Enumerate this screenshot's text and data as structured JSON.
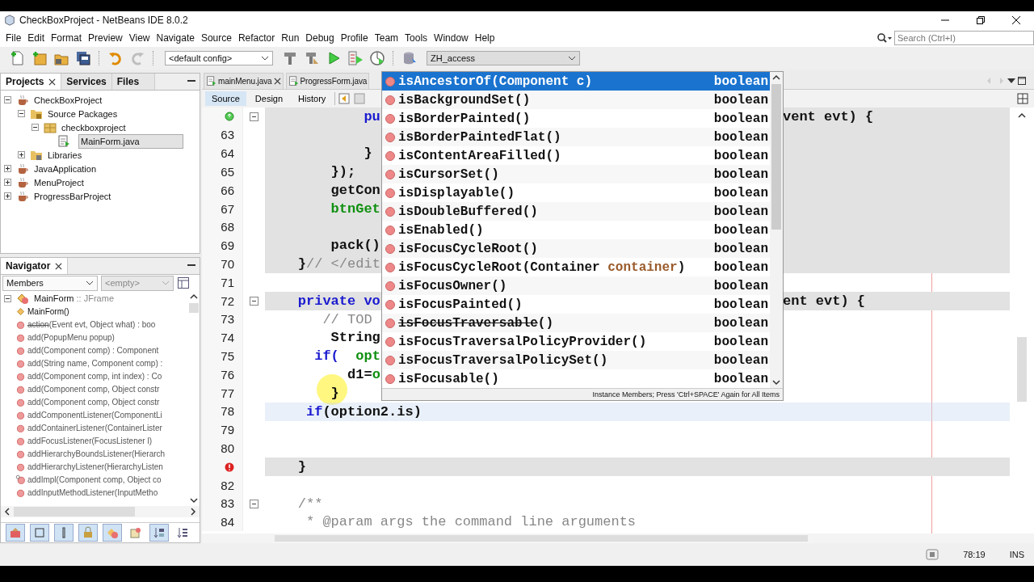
{
  "window": {
    "title": "CheckBoxProject - NetBeans IDE 8.0.2"
  },
  "menu": [
    "File",
    "Edit",
    "Format",
    "Preview",
    "View",
    "Navigate",
    "Source",
    "Refactor",
    "Run",
    "Debug",
    "Profile",
    "Team",
    "Tools",
    "Window",
    "Help"
  ],
  "search": {
    "placeholder": "Search (Ctrl+I)"
  },
  "toolbar": [
    {
      "kind": "new-file",
      "disabled": false
    },
    {
      "kind": "new-project",
      "disabled": false
    },
    {
      "kind": "open-project",
      "disabled": false
    },
    {
      "kind": "save-all",
      "disabled": false
    },
    {
      "kind": "separator"
    },
    {
      "kind": "undo",
      "disabled": false
    },
    {
      "kind": "redo",
      "disabled": true
    },
    {
      "kind": "separator"
    },
    {
      "kind": "config",
      "value": "<default config>"
    },
    {
      "kind": "build",
      "disabled": false
    },
    {
      "kind": "clean-build",
      "disabled": false
    },
    {
      "kind": "run",
      "disabled": false
    },
    {
      "kind": "debug",
      "disabled": false
    },
    {
      "kind": "profile",
      "disabled": false
    },
    {
      "kind": "separator"
    },
    {
      "kind": "database",
      "disabled": false
    },
    {
      "kind": "connection",
      "value": "ZH_access"
    }
  ],
  "projects_panel": {
    "tabs": [
      {
        "label": "Projects",
        "selected": true,
        "closable": true
      },
      {
        "label": "Services",
        "selected": false,
        "closable": false
      },
      {
        "label": "Files",
        "selected": false,
        "closable": false
      }
    ],
    "tree": [
      {
        "label": "CheckBoxProject",
        "kind": "project",
        "expanded": true,
        "selected": false,
        "children": [
          {
            "label": "Source Packages",
            "kind": "source-packages",
            "expanded": true,
            "selected": false,
            "children": [
              {
                "label": "checkboxproject",
                "kind": "package",
                "expanded": true,
                "selected": false,
                "children": [
                  {
                    "label": "MainForm.java",
                    "kind": "java-file",
                    "selected": true
                  }
                ]
              }
            ]
          },
          {
            "label": "Libraries",
            "kind": "libraries",
            "expanded": false,
            "selected": false
          }
        ]
      },
      {
        "label": "JavaApplication",
        "kind": "project",
        "expanded": false,
        "selected": false
      },
      {
        "label": "MenuProject",
        "kind": "project",
        "expanded": false,
        "selected": false
      },
      {
        "label": "ProgressBarProject",
        "kind": "project",
        "expanded": false,
        "selected": false
      }
    ]
  },
  "navigator": {
    "title": "Navigator",
    "filter": "Members",
    "scope": "<empty>",
    "root": {
      "name": "MainForm",
      "type": ":: JFrame",
      "expanded": true
    },
    "members": [
      {
        "kind": "constructor",
        "name": "MainForm()",
        "deprecated": false
      },
      {
        "kind": "method",
        "name": "action",
        "signature": "(Event evt, Object what) : boo",
        "deprecated": true
      },
      {
        "kind": "method",
        "name": "add",
        "signature": "(PopupMenu popup)",
        "deprecated": false
      },
      {
        "kind": "method",
        "name": "add",
        "signature": "(Component comp) : Component",
        "deprecated": false
      },
      {
        "kind": "method",
        "name": "add",
        "signature": "(String name, Component comp) :",
        "deprecated": false
      },
      {
        "kind": "method",
        "name": "add",
        "signature": "(Component comp, int index) : Co",
        "deprecated": false
      },
      {
        "kind": "method",
        "name": "add",
        "signature": "(Component comp, Object constr",
        "deprecated": false
      },
      {
        "kind": "method",
        "name": "add",
        "signature": "(Component comp, Object constr",
        "deprecated": false
      },
      {
        "kind": "method",
        "name": "addComponentListener",
        "signature": "(ComponentLi",
        "deprecated": false
      },
      {
        "kind": "method",
        "name": "addContainerListener",
        "signature": "(ContainerLister",
        "deprecated": false
      },
      {
        "kind": "method",
        "name": "addFocusListener",
        "signature": "(FocusListener l)",
        "deprecated": false
      },
      {
        "kind": "method",
        "name": "addHierarchyBoundsListener",
        "signature": "(Hierarch",
        "deprecated": false
      },
      {
        "kind": "method",
        "name": "addHierarchyListener",
        "signature": "(HierarchyListen",
        "deprecated": false
      },
      {
        "kind": "protected",
        "name": "addImpl",
        "signature": "(Component comp, Object co",
        "deprecated": false
      },
      {
        "kind": "method",
        "name": "addInputMethodListener",
        "signature": "(InputMetho",
        "deprecated": false
      }
    ],
    "tools": [
      {
        "kind": "fields",
        "on": true
      },
      {
        "kind": "static",
        "on": true
      },
      {
        "kind": "nonpublic",
        "on": true
      },
      {
        "kind": "private",
        "on": true
      },
      {
        "kind": "inherited",
        "on": true
      },
      {
        "kind": "fqn",
        "on": false
      },
      {
        "kind": "sort-source",
        "on": true
      },
      {
        "kind": "sort-name",
        "on": false
      }
    ]
  },
  "editor": {
    "tabs": [
      {
        "label": "mainMenu.java",
        "closable": true
      },
      {
        "label": "ProgressForm.java",
        "closable": false
      }
    ],
    "views": [
      {
        "label": "Source",
        "selected": true
      },
      {
        "label": "Design",
        "selected": false
      },
      {
        "label": "History",
        "selected": false
      }
    ],
    "lines": [
      {
        "override": true,
        "error": false,
        "kind": "guarded",
        "fold": true,
        "spans": [
          {
            "text": "            pu",
            "kind": "keyword"
          }
        ],
        "tail": "vent evt) {"
      },
      {
        "number": "63",
        "override": false,
        "error": false,
        "kind": "guarded",
        "fold": false
      },
      {
        "number": "64",
        "override": false,
        "error": false,
        "kind": "guarded",
        "fold": false,
        "spans": [
          {
            "text": "            }",
            "kind": "plain"
          }
        ]
      },
      {
        "number": "65",
        "override": false,
        "error": false,
        "kind": "guarded",
        "fold": false,
        "spans": [
          {
            "text": "        });",
            "kind": "plain"
          }
        ]
      },
      {
        "number": "66",
        "override": false,
        "error": false,
        "kind": "guarded",
        "fold": false,
        "spans": [
          {
            "text": "        getCon",
            "kind": "plain"
          }
        ]
      },
      {
        "number": "67",
        "override": false,
        "error": false,
        "kind": "guarded",
        "fold": false,
        "spans": [
          {
            "text": "        btnGet",
            "kind": "field"
          }
        ]
      },
      {
        "number": "68",
        "override": false,
        "error": false,
        "kind": "guarded",
        "fold": false
      },
      {
        "number": "69",
        "override": false,
        "error": false,
        "kind": "guarded",
        "fold": false,
        "spans": [
          {
            "text": "        pack()",
            "kind": "plain"
          }
        ]
      },
      {
        "number": "70",
        "override": false,
        "error": false,
        "kind": "guarded",
        "fold": false,
        "spans": [
          {
            "text": "    }",
            "kind": "plain"
          },
          {
            "text": "// </edit",
            "kind": "comment"
          }
        ]
      },
      {
        "number": "71",
        "override": false,
        "error": false,
        "kind": "plain",
        "fold": false
      },
      {
        "number": "72",
        "override": false,
        "error": false,
        "kind": "guarded",
        "fold": true,
        "spans": [
          {
            "text": "    private vo",
            "kind": "keyword"
          }
        ],
        "tail": "ent evt) {"
      },
      {
        "number": "73",
        "override": false,
        "error": false,
        "kind": "plain",
        "fold": false,
        "spans": [
          {
            "text": "       // TOD",
            "kind": "comment"
          }
        ]
      },
      {
        "number": "74",
        "override": false,
        "error": false,
        "kind": "plain",
        "fold": false,
        "spans": [
          {
            "text": "        String",
            "kind": "plain"
          }
        ]
      },
      {
        "number": "75",
        "override": false,
        "error": false,
        "kind": "plain",
        "fold": false,
        "spans": [
          {
            "text": "      if(",
            "kind": "keyword"
          },
          {
            "text": "  opt",
            "kind": "field"
          }
        ]
      },
      {
        "number": "76",
        "override": false,
        "error": false,
        "kind": "plain",
        "fold": false,
        "spans": [
          {
            "text": "          d1=",
            "kind": "plain"
          },
          {
            "text": "o",
            "kind": "field"
          }
        ]
      },
      {
        "number": "77",
        "override": false,
        "error": false,
        "kind": "plain",
        "fold": false,
        "spans": [
          {
            "text": "        }",
            "kind": "plain"
          }
        ]
      },
      {
        "number": "78",
        "override": false,
        "error": false,
        "kind": "current",
        "fold": false,
        "spans": [
          {
            "text": "     if",
            "kind": "keyword"
          },
          {
            "text": "(option2.is)",
            "kind": "plain"
          }
        ]
      },
      {
        "number": "79",
        "override": false,
        "error": false,
        "kind": "plain",
        "fold": false
      },
      {
        "number": "80",
        "override": false,
        "error": false,
        "kind": "plain",
        "fold": false
      },
      {
        "override": false,
        "error": true,
        "kind": "guarded",
        "fold": false,
        "spans": [
          {
            "text": "    }",
            "kind": "plain"
          }
        ]
      },
      {
        "number": "82",
        "override": false,
        "error": false,
        "kind": "plain",
        "fold": false
      },
      {
        "number": "83",
        "override": false,
        "error": false,
        "kind": "plain",
        "fold": true,
        "spans": [
          {
            "text": "    /**",
            "kind": "comment"
          }
        ]
      },
      {
        "number": "84",
        "override": false,
        "error": false,
        "kind": "plain",
        "fold": false,
        "spans": [
          {
            "text": "     * @param args the command line arguments",
            "kind": "comment"
          }
        ]
      }
    ],
    "completion": {
      "items": [
        {
          "parts": [
            {
              "text": "isAncestorOf(Component c)",
              "kind": "name"
            }
          ],
          "type": "boolean",
          "selected": true,
          "deprecated": false
        },
        {
          "parts": [
            {
              "text": "isBackgroundSet()",
              "kind": "name"
            }
          ],
          "type": "boolean",
          "selected": false,
          "deprecated": false
        },
        {
          "parts": [
            {
              "text": "isBorderPainted()",
              "kind": "name"
            }
          ],
          "type": "boolean",
          "selected": false,
          "deprecated": false
        },
        {
          "parts": [
            {
              "text": "isBorderPaintedFlat()",
              "kind": "name"
            }
          ],
          "type": "boolean",
          "selected": false,
          "deprecated": false
        },
        {
          "parts": [
            {
              "text": "isContentAreaFilled()",
              "kind": "name"
            }
          ],
          "type": "boolean",
          "selected": false,
          "deprecated": false
        },
        {
          "parts": [
            {
              "text": "isCursorSet()",
              "kind": "name"
            }
          ],
          "type": "boolean",
          "selected": false,
          "deprecated": false
        },
        {
          "parts": [
            {
              "text": "isDisplayable()",
              "kind": "name"
            }
          ],
          "type": "boolean",
          "selected": false,
          "deprecated": false
        },
        {
          "parts": [
            {
              "text": "isDoubleBuffered()",
              "kind": "name"
            }
          ],
          "type": "boolean",
          "selected": false,
          "deprecated": false
        },
        {
          "parts": [
            {
              "text": "isEnabled()",
              "kind": "name"
            }
          ],
          "type": "boolean",
          "selected": false,
          "deprecated": false
        },
        {
          "parts": [
            {
              "text": "isFocusCycleRoot()",
              "kind": "name"
            }
          ],
          "type": "boolean",
          "selected": false,
          "deprecated": false
        },
        {
          "parts": [
            {
              "text": "isFocusCycleRoot(Container ",
              "kind": "name"
            },
            {
              "text": "container",
              "kind": "param"
            },
            {
              "text": ")",
              "kind": "name"
            }
          ],
          "type": "boolean",
          "selected": false,
          "deprecated": false
        },
        {
          "parts": [
            {
              "text": "isFocusOwner()",
              "kind": "name"
            }
          ],
          "type": "boolean",
          "selected": false,
          "deprecated": false
        },
        {
          "parts": [
            {
              "text": "isFocusPainted()",
              "kind": "name"
            }
          ],
          "type": "boolean",
          "selected": false,
          "deprecated": false
        },
        {
          "parts": [
            {
              "text": "isFocusTraversable",
              "kind": "name"
            },
            {
              "text": "()",
              "kind": "name"
            }
          ],
          "type": "boolean",
          "selected": false,
          "deprecated": true
        },
        {
          "parts": [
            {
              "text": "isFocusTraversalPolicyProvider()",
              "kind": "name"
            }
          ],
          "type": "boolean",
          "selected": false,
          "deprecated": false
        },
        {
          "parts": [
            {
              "text": "isFocusTraversalPolicySet()",
              "kind": "name"
            }
          ],
          "type": "boolean",
          "selected": false,
          "deprecated": false
        },
        {
          "parts": [
            {
              "text": "isFocusable()",
              "kind": "name"
            }
          ],
          "type": "boolean",
          "selected": false,
          "deprecated": false
        }
      ],
      "footer": "Instance Members; Press 'Ctrl+SPACE' Again for All Items"
    }
  },
  "status_bar": {
    "position": "78:19",
    "mode": "INS"
  }
}
